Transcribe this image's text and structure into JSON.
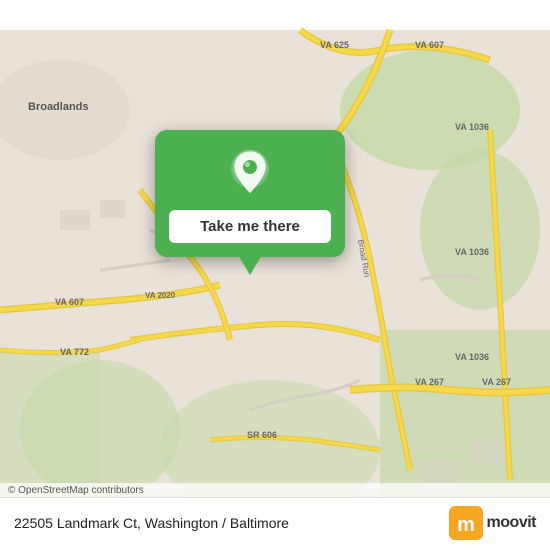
{
  "map": {
    "alt": "Map of 22505 Landmark Ct area, Washington / Baltimore"
  },
  "popup": {
    "button_label": "Take me there"
  },
  "bottom_bar": {
    "address": "22505 Landmark Ct, Washington / Baltimore",
    "moovit_label": "moovit"
  },
  "copyright": {
    "text": "© OpenStreetMap contributors"
  },
  "colors": {
    "popup_bg": "#4caf50",
    "road_primary": "#e8c84a",
    "road_secondary": "#f0d080",
    "map_bg": "#e8e0d4",
    "green_area": "#c8ddb0",
    "water": "#a8c8e8"
  }
}
